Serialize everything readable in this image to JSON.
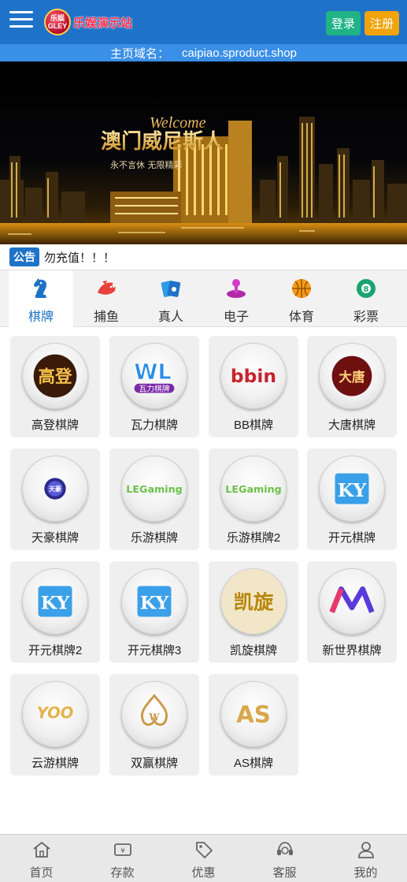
{
  "header": {
    "logo_badge": "乐娱 GLEY",
    "logo_text": "乐娱演示站",
    "login_label": "登录",
    "register_label": "注册"
  },
  "domain_bar": {
    "label": "主页域名：",
    "value": "caipiao.sproduct.shop"
  },
  "banner": {
    "welcome": "Welcome",
    "title": "澳门威尼斯人",
    "subtitle": "永不言休 无限精彩"
  },
  "notice": {
    "tag": "公告",
    "text": "勿充值！！！"
  },
  "tabs": [
    {
      "label": "棋牌",
      "icon": "knight-icon",
      "active": true
    },
    {
      "label": "捕鱼",
      "icon": "fish-icon",
      "active": false
    },
    {
      "label": "真人",
      "icon": "cards-icon",
      "active": false
    },
    {
      "label": "电子",
      "icon": "joystick-icon",
      "active": false
    },
    {
      "label": "体育",
      "icon": "basketball-icon",
      "active": false
    },
    {
      "label": "彩票",
      "icon": "lottery-ball-icon",
      "active": false
    }
  ],
  "games": [
    {
      "label": "高登棋牌",
      "logo": "高登"
    },
    {
      "label": "瓦力棋牌",
      "logo": "WL"
    },
    {
      "label": "BB棋牌",
      "logo": "bbin"
    },
    {
      "label": "大唐棋牌",
      "logo": "大唐"
    },
    {
      "label": "天豪棋牌",
      "logo": "天豪"
    },
    {
      "label": "乐游棋牌",
      "logo": "LEGaming"
    },
    {
      "label": "乐游棋牌2",
      "logo": "LEGaming"
    },
    {
      "label": "开元棋牌",
      "logo": "KY"
    },
    {
      "label": "开元棋牌2",
      "logo": "KY"
    },
    {
      "label": "开元棋牌3",
      "logo": "KY"
    },
    {
      "label": "凯旋棋牌",
      "logo": "凯旋"
    },
    {
      "label": "新世界棋牌",
      "logo": "NW"
    },
    {
      "label": "云游棋牌",
      "logo": "YOO"
    },
    {
      "label": "双赢棋牌",
      "logo": "W"
    },
    {
      "label": "AS棋牌",
      "logo": "AS"
    }
  ],
  "bottom_nav": [
    {
      "label": "首页",
      "icon": "home-icon"
    },
    {
      "label": "存款",
      "icon": "deposit-icon"
    },
    {
      "label": "优惠",
      "icon": "tag-icon"
    },
    {
      "label": "客服",
      "icon": "headset-icon"
    },
    {
      "label": "我的",
      "icon": "user-icon"
    }
  ],
  "colors": {
    "primary": "#1e72c8",
    "login": "#1fb385",
    "register": "#f0a30a"
  }
}
